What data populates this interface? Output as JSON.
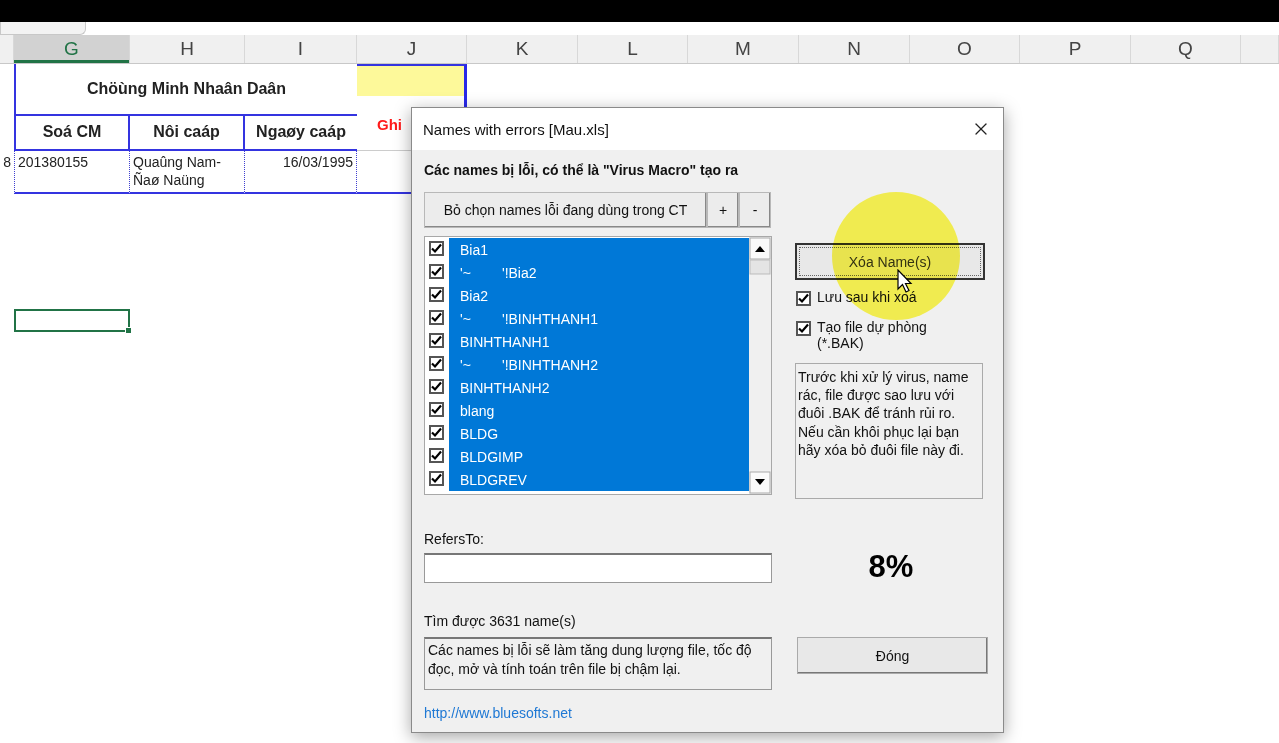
{
  "sheet": {
    "columns": [
      {
        "label": "G",
        "selected": true
      },
      {
        "label": "H",
        "selected": false
      },
      {
        "label": "I",
        "selected": false
      },
      {
        "label": "J",
        "selected": false
      },
      {
        "label": "K",
        "selected": false
      },
      {
        "label": "L",
        "selected": false
      },
      {
        "label": "M",
        "selected": false
      },
      {
        "label": "N",
        "selected": false
      },
      {
        "label": "O",
        "selected": false
      },
      {
        "label": "P",
        "selected": false
      },
      {
        "label": "Q",
        "selected": false
      }
    ],
    "group_header": "Chöùng Minh Nhaân Daân",
    "headers": [
      "Soá CM",
      "Nôi caáp",
      "Ngaøy caáp"
    ],
    "note_header": "Ghi",
    "cut_cell": "8",
    "cells": [
      "201380155",
      "Quaûng Nam-Ñaø Naüng",
      "16/03/1995"
    ]
  },
  "dialog": {
    "title": "Names with errors [Mau.xls]",
    "heading": "Các names bị lỗi, có thể là \"Virus Macro\" tạo ra",
    "toolbar": [
      "Bỏ chọn names lỗi đang dùng trong CT",
      "+",
      "-"
    ],
    "names": [
      {
        "label": "Bia1",
        "checked": true,
        "selected": true
      },
      {
        "label": "'~        '!Bia2",
        "checked": true,
        "selected": true
      },
      {
        "label": "Bia2",
        "checked": true,
        "selected": true
      },
      {
        "label": "'~        '!BINHTHANH1",
        "checked": true,
        "selected": true
      },
      {
        "label": "BINHTHANH1",
        "checked": true,
        "selected": true
      },
      {
        "label": "'~        '!BINHTHANH2",
        "checked": true,
        "selected": true
      },
      {
        "label": "BINHTHANH2",
        "checked": true,
        "selected": true
      },
      {
        "label": "blang",
        "checked": true,
        "selected": true
      },
      {
        "label": "BLDG",
        "checked": true,
        "selected": true
      },
      {
        "label": "BLDGIMP",
        "checked": true,
        "selected": true
      },
      {
        "label": "BLDGREV",
        "checked": true,
        "selected": true
      }
    ],
    "delete_button": "Xóa Name(s)",
    "options": [
      {
        "label": "Lưu sau khi xoá",
        "checked": true
      },
      {
        "label": "Tạo file dự phòng (*.BAK)",
        "checked": true
      }
    ],
    "backup_note": "Trước khi xử lý virus, name rác, file được sao lưu với đuôi .BAK để tránh rủi ro. Nếu cần khôi phục lại bạn hãy xóa bỏ đuôi file này đi.",
    "refers_to_label": "RefersTo:",
    "progress": "8%",
    "found": "Tìm được 3631 name(s)",
    "info": "Các names bị lỗi sẽ làm tăng dung lượng file, tốc độ đọc,  mở và tính toán trên file bị chậm lại.",
    "close_button": "Đóng",
    "link": "http://www.bluesofts.net"
  }
}
